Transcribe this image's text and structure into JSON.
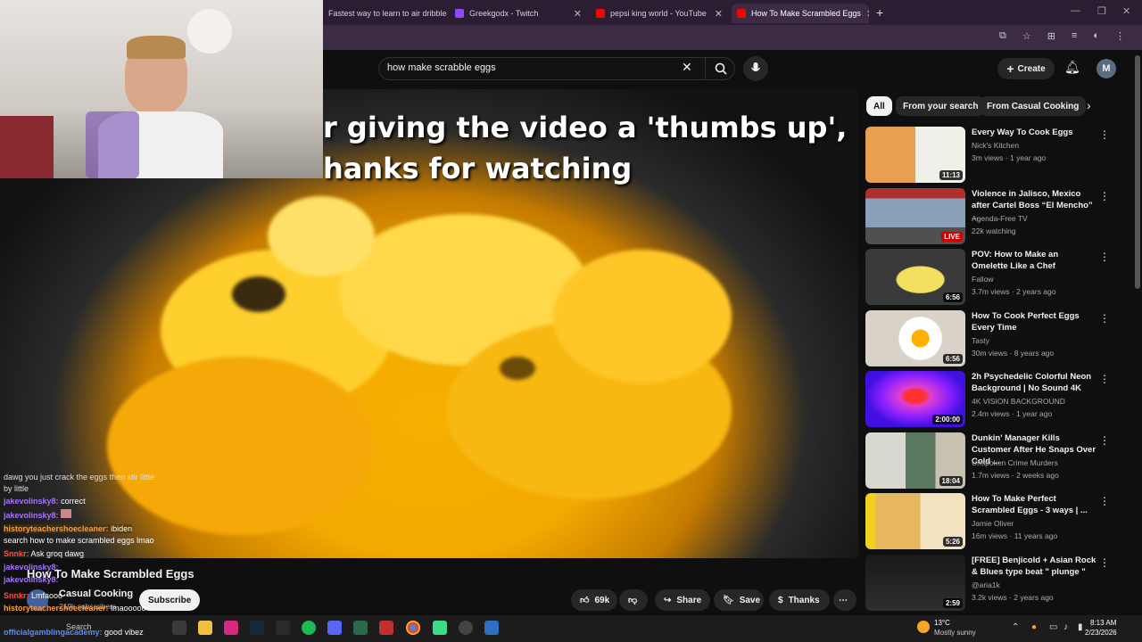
{
  "tabs": [
    {
      "label": "Fastest way to learn to air dribble",
      "color": "#888888"
    },
    {
      "label": "Greekgodx - Twitch",
      "color": "#9146ff"
    },
    {
      "label": "pepsi king world - YouTube",
      "color": "#ff0000"
    },
    {
      "label": "How To Make Scrambled Eggs",
      "color": "#ff0000",
      "active": true
    }
  ],
  "search": {
    "query": "how make scrabble eggs"
  },
  "header": {
    "create_label": "Create",
    "avatar_letter": "M"
  },
  "video": {
    "caption_line1": "r giving the video a 'thumbs up',",
    "caption_line2": "hanks for watching",
    "title": "How To Make Scrambled Eggs",
    "channel": "Casual Cooking",
    "subscribers": "219k subscribers",
    "subscribe_label": "Subscribe",
    "likes": "69k",
    "share_label": "Share",
    "save_label": "Save",
    "thanks_label": "Thanks"
  },
  "chips": [
    "All",
    "From your search",
    "From Casual Cooking"
  ],
  "recommendations": [
    {
      "title": "Every Way To Cook Eggs",
      "channel": "Nick's Kitchen",
      "meta": "3m views · 1 year ago",
      "duration": "11:13",
      "thumb": "#d9a05a"
    },
    {
      "title": "Violence in Jalisco, Mexico after Cartel Boss “El Mencho” ...",
      "channel": "Agenda-Free TV",
      "meta": "22k watching",
      "duration": "LIVE",
      "thumb": "#7a8ea8"
    },
    {
      "title": "POV: How to Make an Omelette Like a Chef",
      "channel": "Fallow",
      "meta": "3.7m views · 2 years ago",
      "duration": "6:56",
      "thumb": "#c9c070"
    },
    {
      "title": "How To Cook Perfect Eggs Every Time",
      "channel": "Tasty",
      "meta": "30m views · 8 years ago",
      "duration": "6:56",
      "thumb": "#e9e2d2"
    },
    {
      "title": "2h Psychedelic Colorful Neon Background | No Sound 4K",
      "channel": "4K VISION BACKGROUND",
      "meta": "2.4m views · 1 year ago",
      "duration": "2:00:00",
      "thumb": "#c020e0"
    },
    {
      "title": "Dunkin' Manager Kills Customer After He Snaps Over Cold ...",
      "channel": "Unspoken Crime Murders",
      "meta": "1.7m views · 2 weeks ago",
      "duration": "18:04",
      "thumb": "#607a70"
    },
    {
      "title": "How To Make Perfect Scrambled Eggs - 3 ways | ...",
      "channel": "Jamie Oliver",
      "meta": "16m views · 11 years ago",
      "duration": "5:26",
      "thumb": "#e0b060"
    },
    {
      "title": "[FREE] Benjicold + Asian Rock & Blues type beat \" plunge \"",
      "channel": "@aria1k",
      "meta": "3.2k views · 2 years ago",
      "duration": "2:59",
      "thumb": "#202020"
    }
  ],
  "chat": [
    {
      "user": "",
      "msg": "dawg you just crack the eggs then stir little",
      "color": "#ffffff"
    },
    {
      "user": "",
      "msg": "by little",
      "color": "#ffffff"
    },
    {
      "user": "jakevolinsky8:",
      "msg": "correct",
      "color": "#a970ff"
    },
    {
      "user": "jakevolinsky8:",
      "msg": "",
      "color": "#a970ff"
    },
    {
      "user": "historyteachershoecleaner:",
      "msg": "ibiden",
      "color": "#ff9a3c"
    },
    {
      "user": "",
      "msg": "search how to make scrambled eggs lmao",
      "color": "#ffffff"
    },
    {
      "user": "Snnkr:",
      "msg": "Ask groq dawg",
      "color": "#ff4d4d"
    },
    {
      "user": "jakevolinsky8:",
      "msg": "",
      "color": "#a970ff"
    },
    {
      "user": "jakevolinsky8:",
      "msg": "",
      "color": "#a970ff"
    },
    {
      "user": "Snnkr:",
      "msg": "Lmfaooo",
      "color": "#ff4d4d"
    },
    {
      "user": "historyteachershoecleaner:",
      "msg": "lmaooooo",
      "color": "#ff9a3c"
    },
    {
      "user": "officialgamblingacademy:",
      "msg": "good vibez",
      "color": "#5a8cff"
    }
  ],
  "taskbar": {
    "search_label": "Search",
    "weather_temp": "13°C",
    "weather_desc": "Mostly sunny",
    "time": "8:13 AM",
    "date": "2/23/2026"
  }
}
